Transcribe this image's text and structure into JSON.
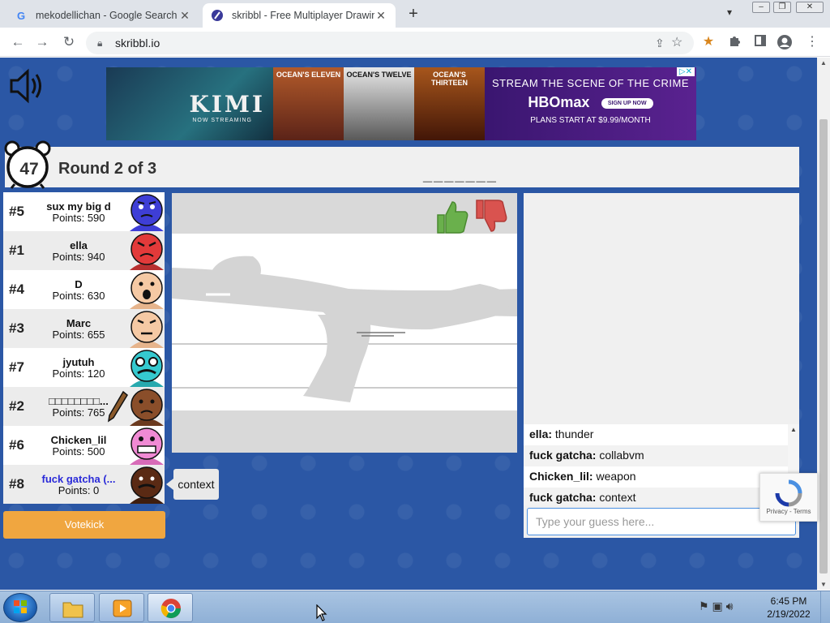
{
  "browser": {
    "tabs": [
      {
        "title": "mekodellichan - Google Search",
        "favicon": "google-g-icon"
      },
      {
        "title": "skribbl - Free Multiplayer Drawing",
        "favicon": "skribbl-icon"
      }
    ],
    "close_glyph": "✕",
    "new_tab_glyph": "+",
    "url": "skribbl.io"
  },
  "ad": {
    "kimi_title": "KIMI",
    "kimi_sub": "NOW STREAMING",
    "posters": [
      "OCEAN'S ELEVEN",
      "OCEAN'S TWELVE",
      "OCEAN'S THIRTEEN"
    ],
    "headline": "STREAM THE SCENE OF THE CRIME",
    "brand": "HBOmax",
    "cta": "SIGN UP NOW",
    "plans": "PLANS START AT $9.99/MONTH"
  },
  "game": {
    "timer": "47",
    "round": "Round 2 of 3",
    "hint": "_______"
  },
  "players": [
    {
      "rank": "#5",
      "name": "sux my big d",
      "points": "Points: 590",
      "color": "#3e3ed6"
    },
    {
      "rank": "#1",
      "name": "ella",
      "points": "Points: 940",
      "color": "#e23a3a"
    },
    {
      "rank": "#4",
      "name": "D",
      "points": "Points: 630",
      "color": "#f5c9a4"
    },
    {
      "rank": "#3",
      "name": "Marc",
      "points": "Points: 655",
      "color": "#f5c9a4"
    },
    {
      "rank": "#7",
      "name": "jyutuh",
      "points": "Points: 120",
      "color": "#35c9cf"
    },
    {
      "rank": "#2",
      "name": "□□□□□□□□...",
      "points": "Points: 765",
      "color": "#8a4e2a"
    },
    {
      "rank": "#6",
      "name": "Chicken_lil",
      "points": "Points: 500",
      "color": "#f08ad4"
    },
    {
      "rank": "#8",
      "name": "fuck gatcha (...",
      "points": "Points: 0",
      "color": "#5a2a14"
    }
  ],
  "votekick_label": "Votekick",
  "bubble_text": "context",
  "chat": {
    "messages": [
      {
        "user": "ella:",
        "text": " thunder"
      },
      {
        "user": "fuck gatcha:",
        "text": " collabvm"
      },
      {
        "user": "Chicken_lil:",
        "text": " weapon"
      },
      {
        "user": "fuck gatcha:",
        "text": " context"
      }
    ],
    "placeholder": "Type your guess here..."
  },
  "recaptcha_text": "Privacy - Terms",
  "taskbar": {
    "time": "6:45 PM",
    "date": "2/19/2022"
  }
}
